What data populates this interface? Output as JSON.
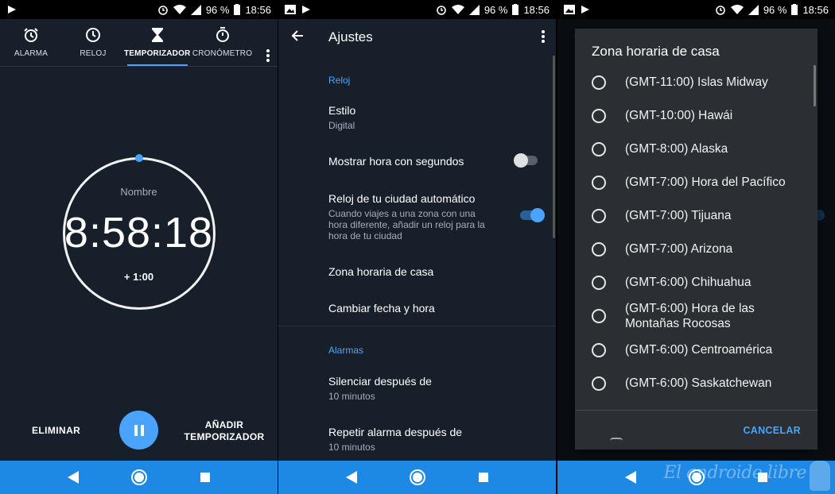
{
  "status_bar": {
    "battery": "96 %",
    "time": "18:56"
  },
  "timer_screen": {
    "tabs": [
      {
        "label": "ALARMA",
        "icon": "alarm-clock-icon"
      },
      {
        "label": "RELOJ",
        "icon": "clock-icon"
      },
      {
        "label": "TEMPORIZADOR",
        "icon": "hourglass-icon",
        "active": true
      },
      {
        "label": "CRONÓMETRO",
        "icon": "stopwatch-icon"
      }
    ],
    "timer": {
      "name": "Nombre",
      "time": "8:58:18",
      "add_minute": "+ 1:00"
    },
    "delete_label": "ELIMINAR",
    "add_timer_label": "AÑADIR TEMPORIZADOR",
    "accent_color": "#4aa3ff"
  },
  "settings_screen": {
    "title": "Ajustes",
    "sections": [
      {
        "label": "Reloj",
        "items": [
          {
            "title": "Estilo",
            "subtitle": "Digital"
          },
          {
            "title": "Mostrar hora con segundos",
            "toggle": false
          },
          {
            "title": "Reloj de tu ciudad automático",
            "subtitle": "Cuando viajes a una zona con una hora diferente, añadir un reloj para la hora de tu ciudad",
            "toggle": true
          },
          {
            "title": "Zona horaria de casa"
          },
          {
            "title": "Cambiar fecha y hora"
          }
        ]
      },
      {
        "label": "Alarmas",
        "items": [
          {
            "title": "Silenciar después de",
            "subtitle": "10 minutos"
          },
          {
            "title": "Repetir alarma después de",
            "subtitle": "10 minutos"
          }
        ]
      }
    ]
  },
  "timezone_dialog": {
    "title": "Zona horaria de casa",
    "options": [
      "(GMT-11:00) Islas Midway",
      "(GMT-10:00) Hawái",
      "(GMT-8:00) Alaska",
      "(GMT-7:00) Hora del Pacífico",
      "(GMT-7:00) Tijuana",
      "(GMT-7:00) Arizona",
      "(GMT-6:00) Chihuahua",
      "(GMT-6:00) Hora de las Montañas Rocosas",
      "(GMT-6:00) Centroamérica",
      "(GMT-6:00) Saskatchewan"
    ],
    "cancel_label": "CANCELAR"
  },
  "watermark": "El androide libre"
}
